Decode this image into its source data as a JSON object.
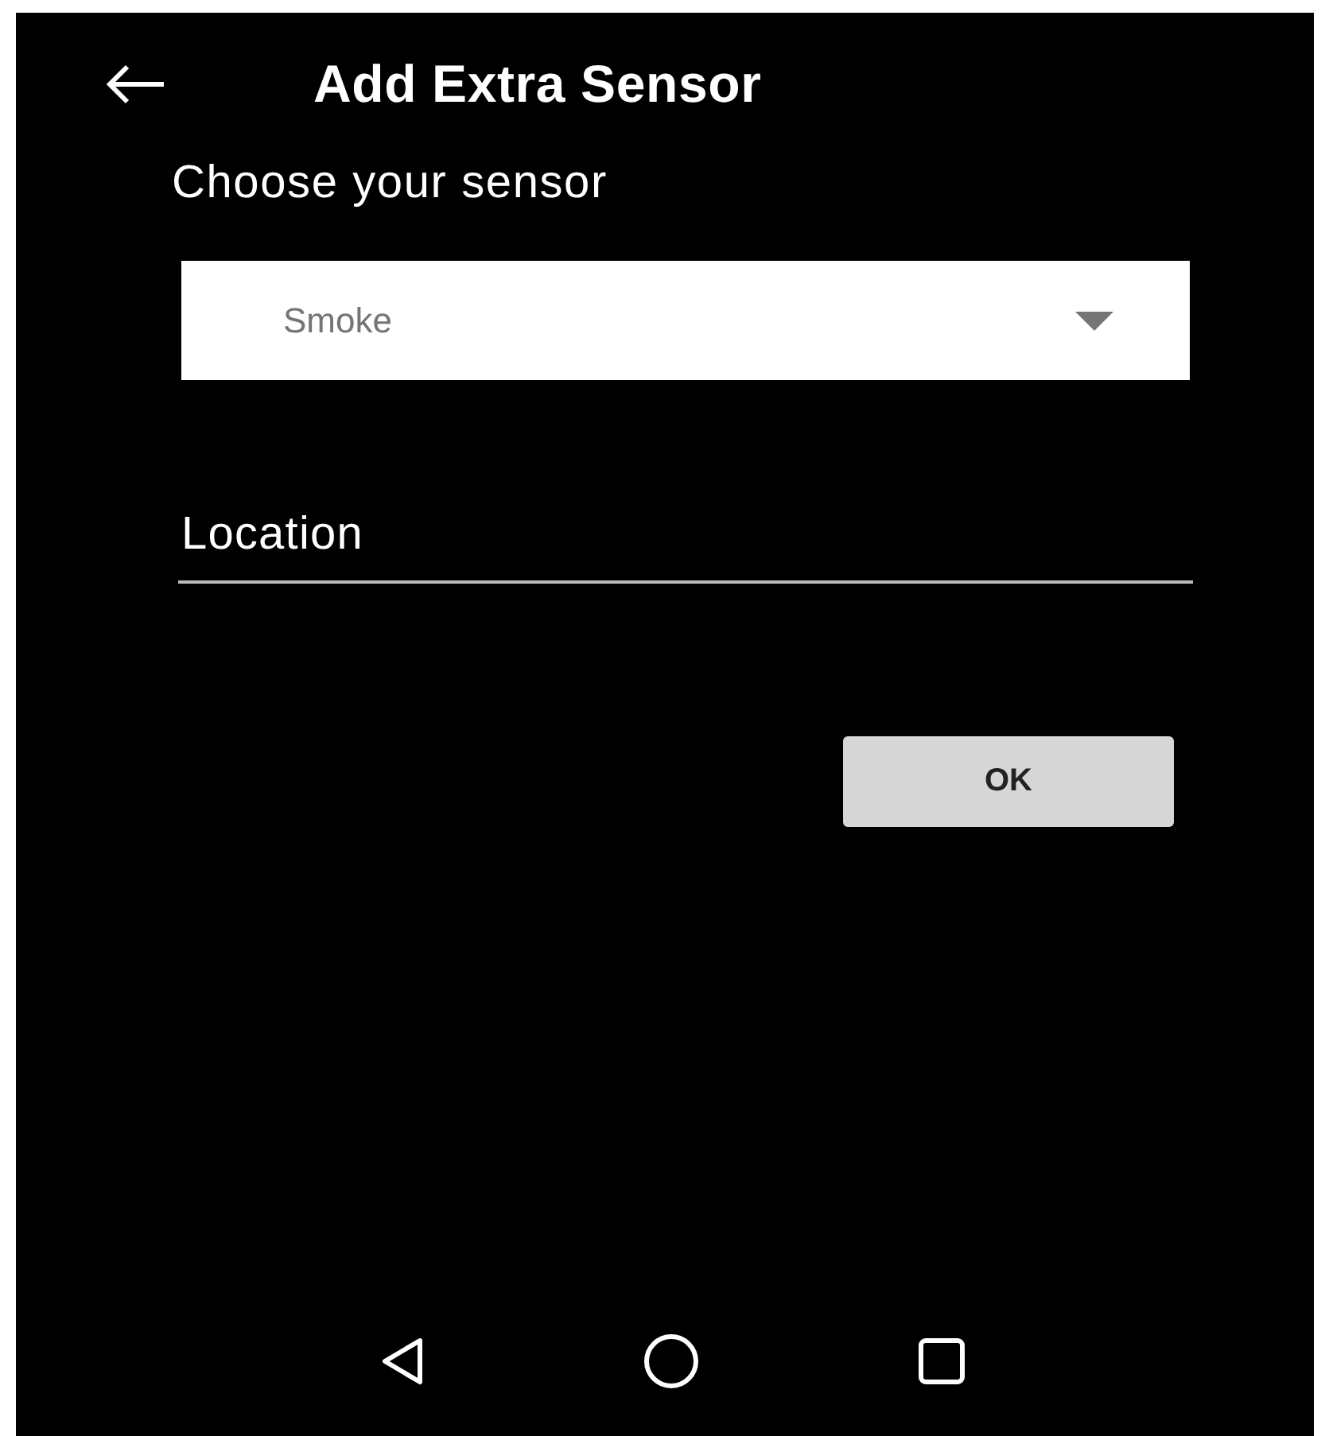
{
  "app_bar": {
    "title": "Add Extra Sensor"
  },
  "prompt": "Choose your sensor",
  "sensor_select": {
    "value": "Smoke"
  },
  "location_field": {
    "placeholder": "Location"
  },
  "ok_button": "OK",
  "nav_bar": [
    {
      "kind": "back"
    },
    {
      "kind": "home"
    },
    {
      "kind": "recents"
    }
  ]
}
